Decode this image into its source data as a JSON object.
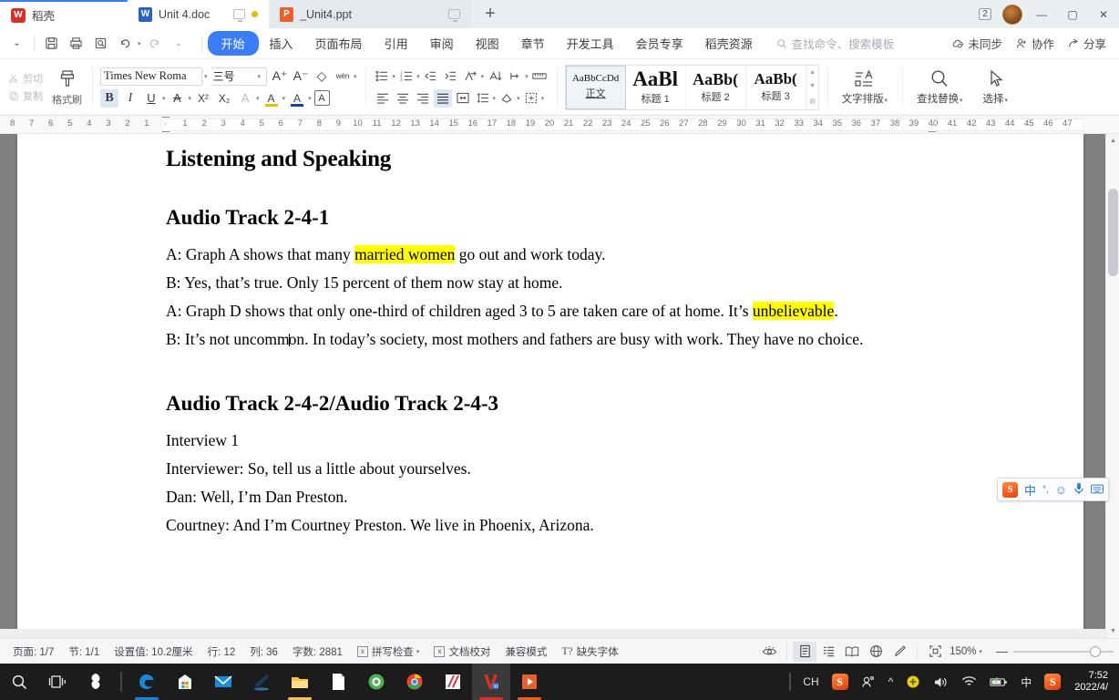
{
  "window": {
    "tabs": [
      {
        "label": "稻壳",
        "icon": "wps-logo-icon",
        "type": "home"
      },
      {
        "label": "Unit 4.doc",
        "icon": "word-doc-icon",
        "type": "doc",
        "has_monitor_icon": true,
        "has_dot": true
      },
      {
        "label": "_Unit4.ppt",
        "icon": "powerpoint-icon",
        "type": "ppt",
        "has_monitor_icon": true
      }
    ],
    "new_tab_label": "+",
    "right_badge": "2",
    "minimize": "—",
    "maximize": "▢",
    "close": "✕"
  },
  "menubar": {
    "quick_access": [
      "save-icon",
      "print-icon",
      "print-preview-icon",
      "undo-icon",
      "redo-icon",
      "customize-icon"
    ],
    "collapse_label": "⌄",
    "menus": [
      {
        "label": "开始",
        "active": true
      },
      {
        "label": "插入",
        "active": false
      },
      {
        "label": "页面布局",
        "active": false
      },
      {
        "label": "引用",
        "active": false
      },
      {
        "label": "审阅",
        "active": false
      },
      {
        "label": "视图",
        "active": false
      },
      {
        "label": "章节",
        "active": false
      },
      {
        "label": "开发工具",
        "active": false
      },
      {
        "label": "会员专享",
        "active": false
      },
      {
        "label": "稻壳资源",
        "active": false
      }
    ],
    "search_placeholder": "查找命令、搜索模板",
    "right_items": [
      {
        "label": "未同步",
        "icon": "cloud-sync-icon"
      },
      {
        "label": "协作",
        "icon": "collaborate-icon"
      },
      {
        "label": "分享",
        "icon": "share-icon"
      }
    ]
  },
  "ribbon": {
    "clipboard": {
      "cut_label": "剪切",
      "copy_label": "复制",
      "format_painter_label": "格式刷"
    },
    "font": {
      "font_family": "Times New Roma",
      "font_size": "三号",
      "grow_font": "A⁺",
      "shrink_font": "A⁻",
      "clear_format": "◇",
      "pinyin_guide": "wén",
      "bold": "B",
      "italic": "I",
      "underline": "U",
      "strikethrough": "A",
      "superscript": "X²",
      "subscript": "X₂",
      "text_effects": "A",
      "highlight": "A",
      "font_color": "A",
      "char_border": "A"
    },
    "paragraph": {
      "bullets": "bullet-list-icon",
      "numbering": "numbered-list-icon",
      "decrease_indent": "decrease-indent-icon",
      "increase_indent": "increase-indent-icon",
      "smart_typeset": "smart-typeset-icon",
      "sort": "sort-icon",
      "show_marks": "show-paragraph-marks-icon",
      "ruler_btn": "ruler-icon",
      "align_left": "align-left-icon",
      "align_center": "align-center-icon",
      "align_right": "align-right-icon",
      "align_justify": "align-justify-icon",
      "distribute": "distribute-icon",
      "line_spacing": "line-spacing-icon",
      "shading": "shading-icon",
      "borders": "borders-icon"
    },
    "styles": [
      {
        "preview": "AaBbCcDd",
        "name": "正文",
        "selected": true
      },
      {
        "preview": "AaBl",
        "name": "标题 1",
        "selected": false
      },
      {
        "preview": "AaBb(",
        "name": "标题 2",
        "selected": false
      },
      {
        "preview": "AaBb(",
        "name": "标题 3",
        "selected": false
      }
    ],
    "tools": [
      {
        "label": "文字排版",
        "icon": "text-typeset-icon",
        "caret": true
      },
      {
        "label": "查找替换",
        "icon": "search-icon",
        "caret": true
      },
      {
        "label": "选择",
        "icon": "select-cursor-icon",
        "caret": true
      }
    ]
  },
  "ruler": {
    "left_ticks": [
      "8",
      "7",
      "6",
      "5",
      "4",
      "3",
      "2",
      "1"
    ],
    "right_ticks": [
      "1",
      "2",
      "3",
      "4",
      "5",
      "6",
      "7",
      "8",
      "9",
      "10",
      "11",
      "12",
      "13",
      "14",
      "15",
      "16",
      "17",
      "18",
      "19",
      "20",
      "21",
      "22",
      "23",
      "24",
      "25",
      "26",
      "27",
      "28",
      "29",
      "30",
      "31",
      "32",
      "33",
      "34",
      "35",
      "36",
      "37",
      "38",
      "39",
      "40",
      "41",
      "42",
      "43",
      "44",
      "45",
      "46",
      "47"
    ]
  },
  "document": {
    "heading1": "Listening and Speaking",
    "heading2": "Audio Track 2-4-1",
    "paragraphs": [
      {
        "id": "p1",
        "pre": "A: Graph A shows that many ",
        "hl": "married women",
        "post": " go out and work today."
      },
      {
        "id": "p2",
        "text": "B: Yes, that’s true. Only 15 percent of them now stay at home."
      },
      {
        "id": "p3",
        "pre": "A:  Graph  D  shows  that  only  one-third  of  children  aged  3  to  5  are  taken  care  of  at  home.  It’s ",
        "hl": "unbelievable",
        "post": "."
      },
      {
        "id": "p4",
        "text": "B: It’s not uncommon. In today’s society, most mothers and fathers are busy with work. They have no choice."
      }
    ],
    "heading3": "Audio Track 2-4-2/Audio Track 2-4-3",
    "paragraphs2": [
      {
        "id": "q1",
        "text": "Interview 1"
      },
      {
        "id": "q2",
        "text": "Interviewer: So, tell us a little about yourselves."
      },
      {
        "id": "q3",
        "text": "Dan: Well, I’m Dan Preston."
      },
      {
        "id": "q4",
        "text": "Courtney: And I’m Courtney Preston. We live in Phoenix, Arizona."
      }
    ]
  },
  "statusbar": {
    "page": "页面: 1/7",
    "section": "节: 1/1",
    "position": "设置值: 10.2厘米",
    "line": "行: 12",
    "column": "列: 36",
    "word_count": "字数: 2881",
    "spellcheck": "拼写检查",
    "proofread": "文档校对",
    "compat_mode": "兼容模式",
    "missing_font": "缺失字体",
    "eye_protect": "eye-protection-icon",
    "views": [
      {
        "name": "page-view-icon",
        "active": true
      },
      {
        "name": "outline-view-icon",
        "active": false
      },
      {
        "name": "read-view-icon",
        "active": false
      },
      {
        "name": "web-view-icon",
        "active": false
      },
      {
        "name": "writing-mode-icon",
        "active": false
      }
    ],
    "fit_icon": "fit-page-icon",
    "zoom": "150%",
    "zoom_minus": "—",
    "zoom_plus": "+"
  },
  "ime": {
    "logo": "S",
    "mode": "中",
    "punctuation": "°,",
    "emoji": "☺",
    "voice": "🎤",
    "keyboard": "⌨"
  },
  "taskbar": {
    "start": "start-icon",
    "task_view": "task-view-icon",
    "items": [
      {
        "name": "sogou-pinyin-icon"
      },
      {
        "name": "edge-browser-icon"
      },
      {
        "name": "microsoft-store-icon"
      },
      {
        "name": "mail-icon"
      },
      {
        "name": "ink-workspace-icon"
      },
      {
        "name": "file-explorer-icon"
      },
      {
        "name": "notepad-icon"
      },
      {
        "name": "360-browser-icon"
      },
      {
        "name": "chrome-icon"
      },
      {
        "name": "xunlei-icon"
      },
      {
        "name": "wps-writer-icon",
        "active": true
      },
      {
        "name": "wps-presentation-icon"
      }
    ],
    "tray": {
      "lang": "CH",
      "snagit": "S",
      "people": "people-icon",
      "chevron": "^",
      "shield": "security-icon",
      "volume": "volume-icon",
      "wifi": "wifi-icon",
      "battery": "battery-icon",
      "ime_mode": "中",
      "sogou": "S",
      "time": "7:52",
      "date": "2022/4/"
    }
  }
}
